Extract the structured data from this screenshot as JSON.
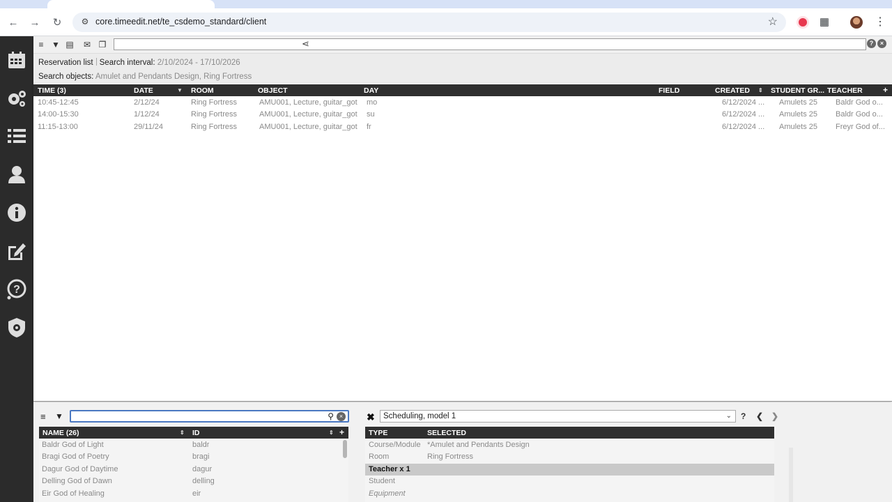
{
  "browser": {
    "url": "core.timeedit.net/te_csdemo_standard/client",
    "icons": [
      "back-icon",
      "forward-icon",
      "reload-icon",
      "site-info-icon",
      "bookmark-star-icon",
      "extension-icon",
      "puzzle-icon",
      "profile-avatar",
      "menu-kebab-icon"
    ]
  },
  "sidebar": {
    "items": [
      "calendar-icon",
      "settings-gears-icon",
      "list-icon",
      "user-icon",
      "info-icon",
      "edit-icon",
      "help-icon",
      "admin-shield-icon"
    ]
  },
  "main": {
    "info": {
      "reservation_list": "Reservation list",
      "search_interval_label": "Search interval:",
      "search_interval_value": "2/10/2024 - 17/10/2026",
      "search_objects_label": "Search objects:",
      "search_objects_value": "Amulet and Pendants Design, Ring Fortress"
    },
    "columns": {
      "time": "TIME (3)",
      "date": "DATE",
      "room": "ROOM",
      "object": "OBJECT",
      "day": "DAY",
      "field": "FIELD",
      "created": "CREATED",
      "student_group": "STUDENT GR...",
      "teacher": "TEACHER",
      "add": "+"
    },
    "rows": [
      {
        "time": "10:45-12:45",
        "date": "2/12/24",
        "room": "Ring Fortress",
        "object": "AMU001, Lecture, guitar_got",
        "day": "mo",
        "created": "6/12/2024 ...",
        "student_group": "Amulets 25",
        "teacher": "Baldr God o..."
      },
      {
        "time": "14:00-15:30",
        "date": "1/12/24",
        "room": "Ring Fortress",
        "object": "AMU001, Lecture, guitar_got",
        "day": "su",
        "created": "6/12/2024 ...",
        "student_group": "Amulets 25",
        "teacher": "Baldr God o..."
      },
      {
        "time": "11:15-13:00",
        "date": "29/11/24",
        "room": "Ring Fortress",
        "object": "AMU001, Lecture, guitar_got",
        "day": "fr",
        "created": "6/12/2024 ...",
        "student_group": "Amulets 25",
        "teacher": "Freyr God of..."
      }
    ]
  },
  "objects_panel": {
    "search_value": "",
    "columns": {
      "name": "NAME (26)",
      "id": "ID",
      "add": "+"
    },
    "rows": [
      {
        "name": "Baldr God of Light",
        "id": "baldr"
      },
      {
        "name": "Bragi God of Poetry",
        "id": "bragi"
      },
      {
        "name": "Dagur God of Daytime",
        "id": "dagur"
      },
      {
        "name": "Delling God of Dawn",
        "id": "delling"
      },
      {
        "name": "Eir God of Healing",
        "id": "eir"
      }
    ]
  },
  "scheduling_panel": {
    "model": "Scheduling, model 1",
    "help": "?",
    "columns": {
      "type": "TYPE",
      "selected": "SELECTED"
    },
    "rows": [
      {
        "type": "Course/Module",
        "selected": "*Amulet and Pendants Design"
      },
      {
        "type": "Room",
        "selected": "Ring Fortress"
      },
      {
        "type": "Teacher x 1",
        "selected": ""
      },
      {
        "type": "Student",
        "selected": ""
      },
      {
        "type": "Equipment",
        "selected": ""
      }
    ]
  }
}
